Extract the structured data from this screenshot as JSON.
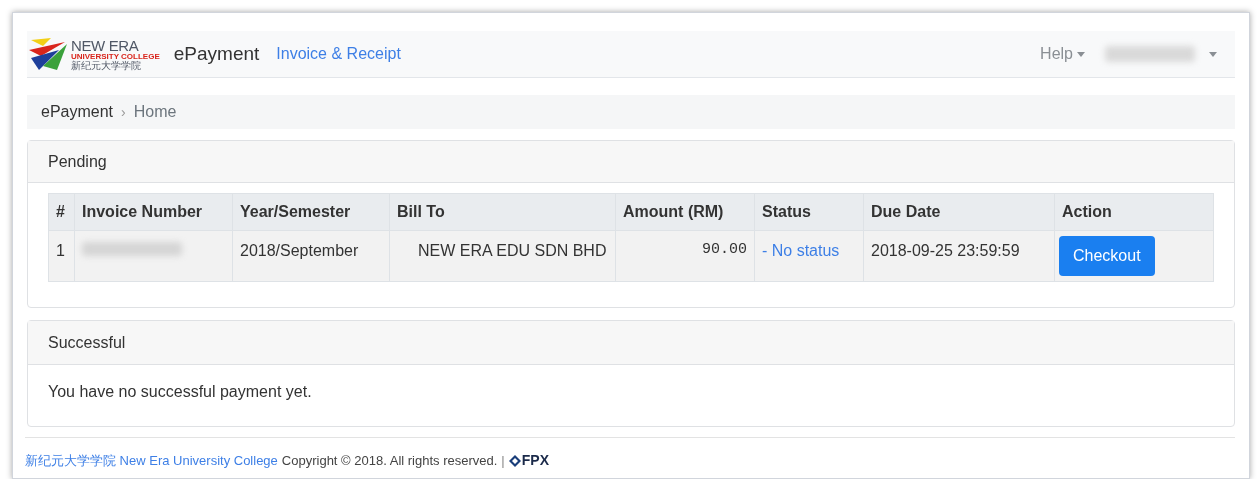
{
  "navbar": {
    "logo": {
      "line1": "NEW ERA",
      "line2": "UNIVERSITY COLLEGE",
      "line3": "新纪元大学学院"
    },
    "brand": "ePayment",
    "links": [
      {
        "label": "Invoice & Receipt"
      }
    ],
    "help": "Help"
  },
  "breadcrumb": {
    "separator": "›",
    "items": [
      "ePayment",
      "Home"
    ]
  },
  "pending": {
    "title": "Pending",
    "table": {
      "columns": [
        "#",
        "Invoice Number",
        "Year/Semester",
        "Bill To",
        "Amount (RM)",
        "Status",
        "Due Date",
        "Action"
      ],
      "rows": [
        {
          "index": "1",
          "year_semester": "2018/September",
          "bill_to": "NEW ERA EDU SDN BHD",
          "amount": "90.00",
          "status": "- No status",
          "due_date": "2018-09-25 23:59:59",
          "action": "Checkout"
        }
      ]
    }
  },
  "successful": {
    "title": "Successful",
    "message": "You have no successful payment yet."
  },
  "footer": {
    "chinese_name": "新纪元大学学院",
    "english_name": "New Era University College",
    "copyright": "Copyright © 2018. All rights reserved.",
    "separator": "|",
    "fpx": "FPX"
  }
}
